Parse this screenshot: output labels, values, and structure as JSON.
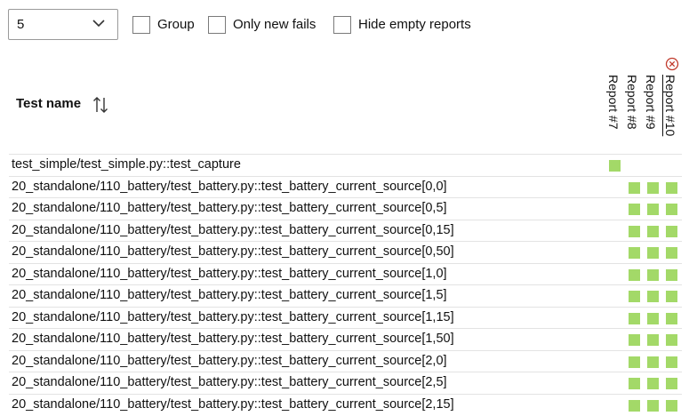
{
  "toolbar": {
    "select_value": "5",
    "group_label": "Group",
    "only_new_fails_label": "Only new fails",
    "hide_empty_label": "Hide empty reports"
  },
  "table": {
    "header_name": "Test name",
    "reports": [
      "Report #7",
      "Report #8",
      "Report #9",
      "Report #10"
    ],
    "pass_color": "#a3d968",
    "rows": [
      {
        "name": "test_simple/test_simple.py::test_capture",
        "results": [
          "pass",
          "",
          "",
          ""
        ]
      },
      {
        "name": "20_standalone/110_battery/test_battery.py::test_battery_current_source[0,0]",
        "results": [
          "",
          "pass",
          "pass",
          "pass"
        ]
      },
      {
        "name": "20_standalone/110_battery/test_battery.py::test_battery_current_source[0,5]",
        "results": [
          "",
          "pass",
          "pass",
          "pass"
        ]
      },
      {
        "name": "20_standalone/110_battery/test_battery.py::test_battery_current_source[0,15]",
        "results": [
          "",
          "pass",
          "pass",
          "pass"
        ]
      },
      {
        "name": "20_standalone/110_battery/test_battery.py::test_battery_current_source[0,50]",
        "results": [
          "",
          "pass",
          "pass",
          "pass"
        ]
      },
      {
        "name": "20_standalone/110_battery/test_battery.py::test_battery_current_source[1,0]",
        "results": [
          "",
          "pass",
          "pass",
          "pass"
        ]
      },
      {
        "name": "20_standalone/110_battery/test_battery.py::test_battery_current_source[1,5]",
        "results": [
          "",
          "pass",
          "pass",
          "pass"
        ]
      },
      {
        "name": "20_standalone/110_battery/test_battery.py::test_battery_current_source[1,15]",
        "results": [
          "",
          "pass",
          "pass",
          "pass"
        ]
      },
      {
        "name": "20_standalone/110_battery/test_battery.py::test_battery_current_source[1,50]",
        "results": [
          "",
          "pass",
          "pass",
          "pass"
        ]
      },
      {
        "name": "20_standalone/110_battery/test_battery.py::test_battery_current_source[2,0]",
        "results": [
          "",
          "pass",
          "pass",
          "pass"
        ]
      },
      {
        "name": "20_standalone/110_battery/test_battery.py::test_battery_current_source[2,5]",
        "results": [
          "",
          "pass",
          "pass",
          "pass"
        ]
      },
      {
        "name": "20_standalone/110_battery/test_battery.py::test_battery_current_source[2,15]",
        "results": [
          "",
          "pass",
          "pass",
          "pass"
        ]
      }
    ]
  },
  "icons": {
    "dropdown": "chevron-down-icon",
    "sort": "sort-arrows-icon",
    "remove_report": "close-circle-icon"
  }
}
